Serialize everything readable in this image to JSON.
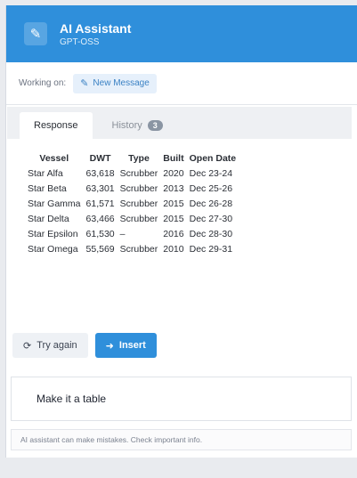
{
  "header": {
    "title": "AI Assistant",
    "subtitle": "GPT-OSS",
    "logo_icon": "edit-pen-icon"
  },
  "workbar": {
    "label": "Working on:",
    "new_message": "New Message"
  },
  "tabs": {
    "response": "Response",
    "history": "History",
    "history_count": "3"
  },
  "table": {
    "headers": [
      "Vessel",
      "DWT",
      "Type",
      "Built",
      "Open Date"
    ],
    "rows": [
      [
        "Star Alfa",
        "63,618",
        "Scrubber",
        "2020",
        "Dec 23-24"
      ],
      [
        "Star Beta",
        "63,301",
        "Scrubber",
        "2013",
        "Dec 25-26"
      ],
      [
        "Star Gamma",
        "61,571",
        "Scrubber",
        "2015",
        "Dec 26-28"
      ],
      [
        "Star Delta",
        "63,466",
        "Scrubber",
        "2015",
        "Dec 27-30"
      ],
      [
        "Star Epsilon",
        "61,530",
        "–",
        "2016",
        "Dec 28-30"
      ],
      [
        "Star Omega",
        "55,569",
        "Scrubber",
        "2010",
        "Dec 29-31"
      ]
    ]
  },
  "actions": {
    "try_again": "Try again",
    "insert": "Insert"
  },
  "input": {
    "value": "Make it a table"
  },
  "disclaimer": "AI assistant can make mistakes. Check important info.",
  "colors": {
    "accent": "#2f8fdb",
    "badge": "#8a95a3"
  }
}
